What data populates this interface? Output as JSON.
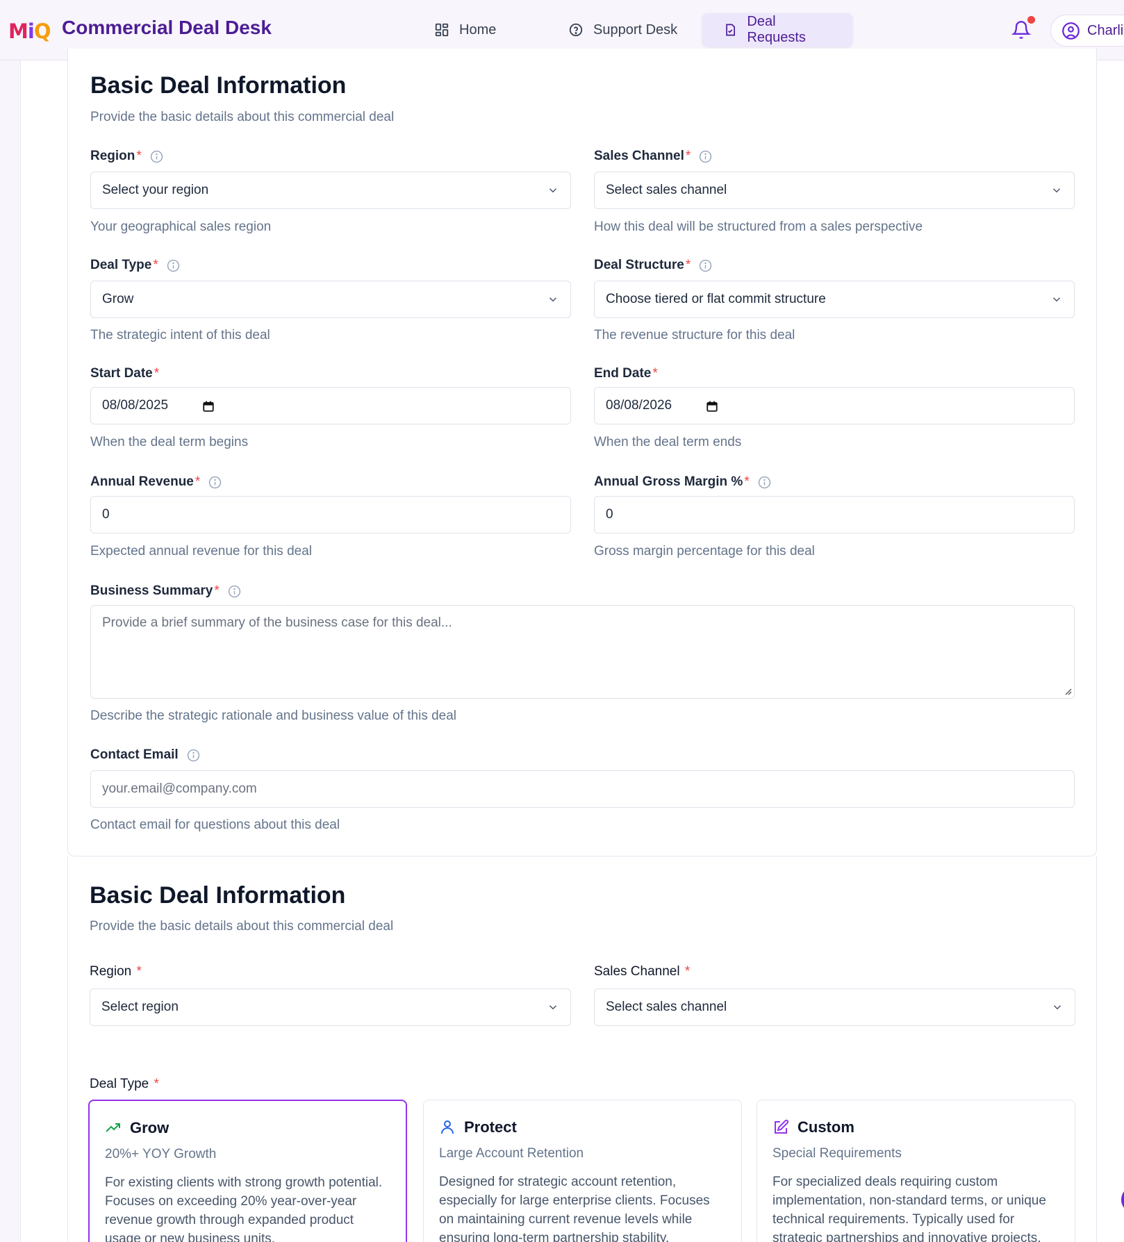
{
  "app": {
    "logo_text": "MiQ",
    "title": "Commercial Deal Desk"
  },
  "nav": {
    "items": [
      {
        "label": "Home",
        "icon": "grid-icon"
      },
      {
        "label": "Support Desk",
        "icon": "help-circle-icon"
      },
      {
        "label": "Deal Requests",
        "icon": "document-icon",
        "active": true
      }
    ],
    "user_name": "Charlie"
  },
  "section1": {
    "title": "Basic Deal Information",
    "subtitle": "Provide the basic details about this commercial deal",
    "region": {
      "label": "Region",
      "placeholder": "Select your region",
      "help": "Your geographical sales region"
    },
    "sales_channel": {
      "label": "Sales Channel",
      "placeholder": "Select sales channel",
      "help": "How this deal will be structured from a sales perspective"
    },
    "deal_type": {
      "label": "Deal Type",
      "value": "Grow",
      "help": "The strategic intent of this deal"
    },
    "deal_structure": {
      "label": "Deal Structure",
      "placeholder": "Choose tiered or flat commit structure",
      "help": "The revenue structure for this deal"
    },
    "start_date": {
      "label": "Start Date",
      "value": "08/08/2025",
      "help": "When the deal term begins"
    },
    "end_date": {
      "label": "End Date",
      "value": "08/08/2026",
      "help": "When the deal term ends"
    },
    "annual_revenue": {
      "label": "Annual Revenue",
      "value": "0",
      "help": "Expected annual revenue for this deal"
    },
    "gross_margin": {
      "label": "Annual Gross Margin %",
      "value": "0",
      "help": "Gross margin percentage for this deal"
    },
    "business_summary": {
      "label": "Business Summary",
      "placeholder": "Provide a brief summary of the business case for this deal...",
      "help": "Describe the strategic rationale and business value of this deal"
    },
    "contact_email": {
      "label": "Contact Email",
      "placeholder": "your.email@company.com",
      "help": "Contact email for questions about this deal"
    },
    "required_mark": "*"
  },
  "section2": {
    "title": "Basic Deal Information",
    "subtitle": "Provide the basic details about this commercial deal",
    "region": {
      "label": "Region",
      "placeholder": "Select region"
    },
    "sales_channel": {
      "label": "Sales Channel",
      "placeholder": "Select sales channel"
    },
    "deal_type_label": "Deal Type",
    "required_mark": "*",
    "deal_types": [
      {
        "name": "Grow",
        "subtitle": "20%+ YOY Growth",
        "description": "For existing clients with strong growth potential. Focuses on exceeding 20% year-over-year revenue growth through expanded product usage or new business units.",
        "icon": "trending-up-icon",
        "icon_color": "#16a34a",
        "selected": true
      },
      {
        "name": "Protect",
        "subtitle": "Large Account Retention",
        "description": "Designed for strategic account retention, especially for large enterprise clients. Focuses on maintaining current revenue levels while ensuring long-term partnership stability.",
        "icon": "user-icon",
        "icon_color": "#2563eb",
        "selected": false
      },
      {
        "name": "Custom",
        "subtitle": "Special Requirements",
        "description": "For specialized deals requiring custom implementation, non-standard terms, or unique technical requirements. Typically used for strategic partnerships and innovative projects.",
        "icon": "edit-icon",
        "icon_color": "#9333ea",
        "selected": false
      }
    ]
  },
  "colors": {
    "brand": "#4c1d95",
    "accent": "#9333ea",
    "required": "#ef4444",
    "notification": "#ef4444"
  }
}
